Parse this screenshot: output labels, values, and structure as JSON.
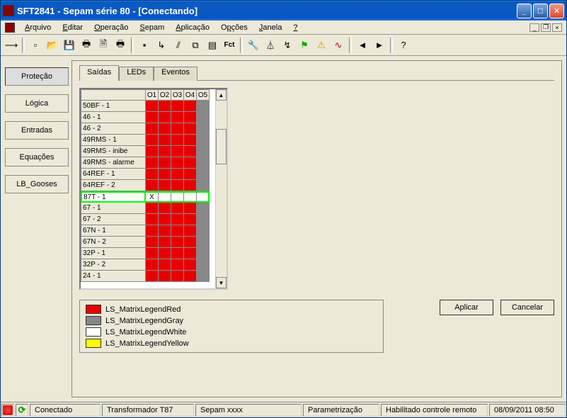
{
  "window": {
    "title": "SFT2841 - Sepam série 80 - [Conectando]"
  },
  "menu": {
    "items": [
      {
        "label": "Arquivo",
        "u": 0
      },
      {
        "label": "Editar",
        "u": 0
      },
      {
        "label": "Operação",
        "u": 0
      },
      {
        "label": "Sepam",
        "u": 0
      },
      {
        "label": "Aplicação",
        "u": 0
      },
      {
        "label": "Opções",
        "u": 1
      },
      {
        "label": "Janela",
        "u": 0
      },
      {
        "label": "?",
        "u": 0
      }
    ]
  },
  "sidebar": {
    "items": [
      {
        "label": "Proteção",
        "active": true
      },
      {
        "label": "Lógica",
        "active": false
      },
      {
        "label": "Entradas",
        "active": false
      },
      {
        "label": "Equações",
        "active": false
      },
      {
        "label": "LB_Gooses",
        "active": false
      }
    ]
  },
  "tabs": {
    "items": [
      {
        "label": "Saídas",
        "active": true
      },
      {
        "label": "LEDs",
        "active": false
      },
      {
        "label": "Eventos",
        "active": false
      }
    ]
  },
  "matrix": {
    "columns": [
      "O1",
      "O2",
      "O3",
      "O4",
      "O5"
    ],
    "rows": [
      {
        "label": "50BF - 1",
        "cells": [
          "red",
          "red",
          "red",
          "red",
          "gray"
        ],
        "selected": false
      },
      {
        "label": "46 - 1",
        "cells": [
          "red",
          "red",
          "red",
          "red",
          "gray"
        ],
        "selected": false
      },
      {
        "label": "46 - 2",
        "cells": [
          "red",
          "red",
          "red",
          "red",
          "gray"
        ],
        "selected": false
      },
      {
        "label": "49RMS - 1",
        "cells": [
          "red",
          "red",
          "red",
          "red",
          "gray"
        ],
        "selected": false
      },
      {
        "label": "49RMS - inibe",
        "cells": [
          "red",
          "red",
          "red",
          "red",
          "gray"
        ],
        "selected": false
      },
      {
        "label": "49RMS - alarme",
        "cells": [
          "red",
          "red",
          "red",
          "red",
          "gray"
        ],
        "selected": false
      },
      {
        "label": "64REF - 1",
        "cells": [
          "red",
          "red",
          "red",
          "red",
          "gray"
        ],
        "selected": false
      },
      {
        "label": "64REF - 2",
        "cells": [
          "red",
          "red",
          "red",
          "red",
          "gray"
        ],
        "selected": false
      },
      {
        "label": "87T - 1",
        "cells": [
          "white",
          "white",
          "white",
          "white",
          "white"
        ],
        "selected": true,
        "mark": "X"
      },
      {
        "label": "67 - 1",
        "cells": [
          "red",
          "red",
          "red",
          "red",
          "gray"
        ],
        "selected": false
      },
      {
        "label": "67 - 2",
        "cells": [
          "red",
          "red",
          "red",
          "red",
          "gray"
        ],
        "selected": false
      },
      {
        "label": "67N - 1",
        "cells": [
          "red",
          "red",
          "red",
          "red",
          "gray"
        ],
        "selected": false
      },
      {
        "label": "67N - 2",
        "cells": [
          "red",
          "red",
          "red",
          "red",
          "gray"
        ],
        "selected": false
      },
      {
        "label": "32P - 1",
        "cells": [
          "red",
          "red",
          "red",
          "red",
          "gray"
        ],
        "selected": false
      },
      {
        "label": "32P - 2",
        "cells": [
          "red",
          "red",
          "red",
          "red",
          "gray"
        ],
        "selected": false
      },
      {
        "label": "24 - 1",
        "cells": [
          "red",
          "red",
          "red",
          "red",
          "gray"
        ],
        "selected": false
      }
    ]
  },
  "legend": {
    "items": [
      {
        "color": "red",
        "label": "LS_MatrixLegendRed"
      },
      {
        "color": "gray",
        "label": "LS_MatrixLegendGray"
      },
      {
        "color": "white",
        "label": "LS_MatrixLegendWhite"
      },
      {
        "color": "yellow",
        "label": "LS_MatrixLegendYellow"
      }
    ]
  },
  "actions": {
    "apply": "Aplicar",
    "cancel": "Cancelar"
  },
  "status": {
    "connected": "Conectado",
    "device": "Transformador T87",
    "sepam": "Sepam xxxx",
    "mode": "Parametrização",
    "remote": "Habilitado controle remoto",
    "datetime": "08/09/2011  08:50"
  }
}
